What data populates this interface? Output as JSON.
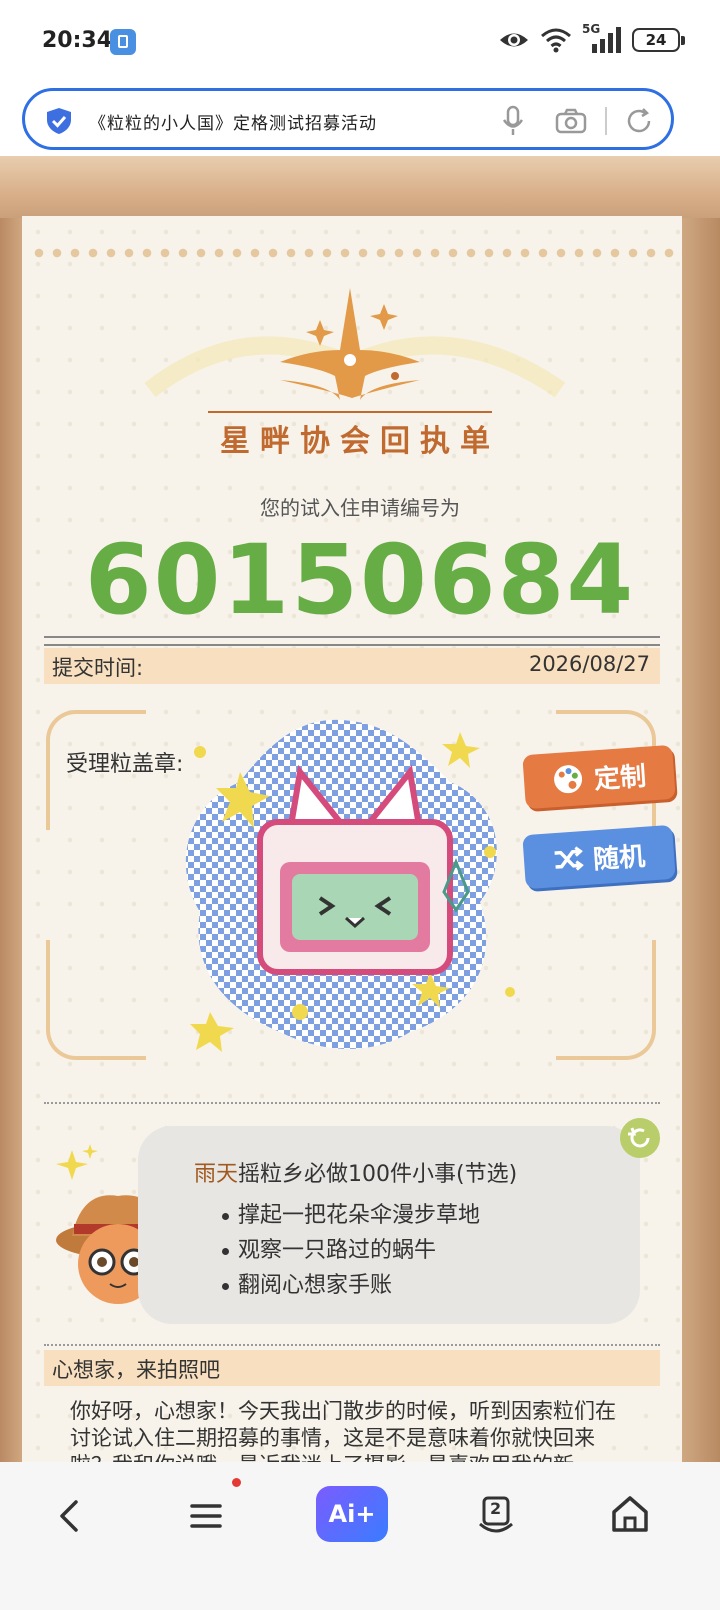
{
  "status": {
    "time": "20:34",
    "network": "5G",
    "battery": "24"
  },
  "address_bar": {
    "url_text": "《粒粒的小人国》定格测试招募活动"
  },
  "receipt": {
    "title": "星畔协会回执单",
    "application_label": "您的试入住申请编号为",
    "application_number": "60150684",
    "submit_time_label": "提交时间:",
    "submit_time_value": "2026/08/27",
    "stamp_label": "受理粒盖章:",
    "custom_button": "定制",
    "random_button": "随机"
  },
  "todo": {
    "weather": "雨天",
    "title_rest": "摇粒乡必做100件小事(节选)",
    "items": [
      "撑起一把花朵伞漫步草地",
      "观察一只路过的蜗牛",
      "翻阅心想家手账"
    ]
  },
  "photo_section": {
    "label": "心想家，来拍照吧",
    "letter": "你好呀，心想家！今天我出门散步的时候，听到因索粒们在讨论试入住二期招募的事情，这是不是意味着你就快回来啦？我和你说哦，最近我迷上了摄影，最喜欢用我的新"
  },
  "bottom_nav": {
    "ai_label": "Ai+",
    "tabs_count": "2"
  },
  "colors": {
    "accent_green": "#66ad45",
    "brand_blue": "#2f6fe4",
    "orange": "#e57a43",
    "blue_button": "#5b8fe0"
  }
}
